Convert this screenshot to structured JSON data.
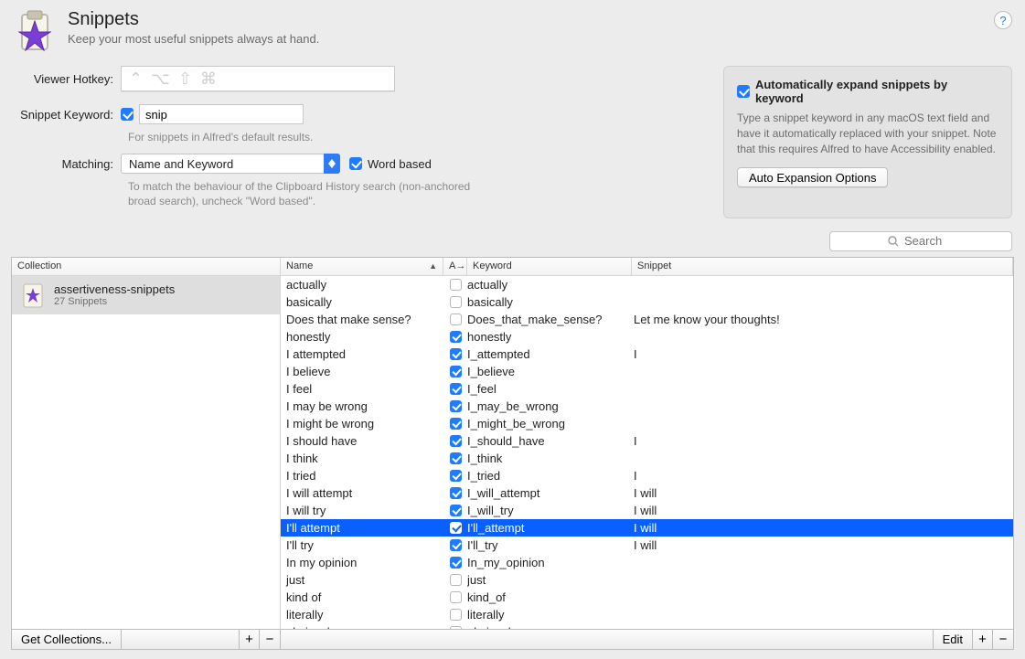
{
  "header": {
    "title": "Snippets",
    "subtitle": "Keep your most useful snippets always at hand."
  },
  "form": {
    "viewer_hotkey_label": "Viewer Hotkey:",
    "viewer_hotkey_glyphs": "⌃ ⌥ ⇧ ⌘",
    "snippet_keyword_label": "Snippet Keyword:",
    "snippet_keyword_value": "snip",
    "snippet_hint": "For snippets in Alfred's default results.",
    "matching_label": "Matching:",
    "matching_value": "Name and Keyword",
    "word_based_label": "Word based",
    "matching_hint": "To match the behaviour of the Clipboard History search (non-anchored broad search), uncheck \"Word based\"."
  },
  "panel": {
    "auto_label": "Automatically expand snippets by keyword",
    "desc": "Type a snippet keyword in any macOS text field and have it automatically replaced with your snippet. Note that this requires Alfred to have Accessibility enabled.",
    "button": "Auto Expansion Options"
  },
  "search": {
    "placeholder": "Search"
  },
  "left": {
    "header": "Collection",
    "collection_name": "assertiveness-snippets",
    "collection_count": "27 Snippets"
  },
  "right": {
    "cols": {
      "name": "Name",
      "a": "A→",
      "keyword": "Keyword",
      "snippet": "Snippet"
    }
  },
  "snippets": [
    {
      "name": "actually",
      "enabled": false,
      "keyword": "actually",
      "snippet": ""
    },
    {
      "name": "basically",
      "enabled": false,
      "keyword": "basically",
      "snippet": ""
    },
    {
      "name": "Does that make sense?",
      "enabled": false,
      "keyword": "Does_that_make_sense?",
      "snippet": "Let me know your thoughts!"
    },
    {
      "name": "honestly",
      "enabled": true,
      "keyword": "honestly",
      "snippet": ""
    },
    {
      "name": "I attempted",
      "enabled": true,
      "keyword": "I_attempted",
      "snippet": "I"
    },
    {
      "name": "I believe",
      "enabled": true,
      "keyword": "I_believe",
      "snippet": ""
    },
    {
      "name": "I feel",
      "enabled": true,
      "keyword": "I_feel",
      "snippet": ""
    },
    {
      "name": "I may be wrong",
      "enabled": true,
      "keyword": "I_may_be_wrong",
      "snippet": ""
    },
    {
      "name": "I might be wrong",
      "enabled": true,
      "keyword": "I_might_be_wrong",
      "snippet": ""
    },
    {
      "name": "I should have",
      "enabled": true,
      "keyword": "I_should_have",
      "snippet": "I"
    },
    {
      "name": "I think",
      "enabled": true,
      "keyword": "I_think",
      "snippet": ""
    },
    {
      "name": "I tried",
      "enabled": true,
      "keyword": "I_tried",
      "snippet": "I"
    },
    {
      "name": "I will attempt",
      "enabled": true,
      "keyword": "I_will_attempt",
      "snippet": "I will"
    },
    {
      "name": "I will try",
      "enabled": true,
      "keyword": "I_will_try",
      "snippet": "I will"
    },
    {
      "name": "I'll attempt",
      "enabled": true,
      "keyword": "I'll_attempt",
      "snippet": "I will",
      "selected": true
    },
    {
      "name": "I'll try",
      "enabled": true,
      "keyword": "I'll_try",
      "snippet": "I will"
    },
    {
      "name": "In my opinion",
      "enabled": true,
      "keyword": "In_my_opinion",
      "snippet": ""
    },
    {
      "name": "just",
      "enabled": false,
      "keyword": "just",
      "snippet": ""
    },
    {
      "name": "kind of",
      "enabled": false,
      "keyword": "kind_of",
      "snippet": ""
    },
    {
      "name": "literally",
      "enabled": false,
      "keyword": "literally",
      "snippet": ""
    },
    {
      "name": "obviously",
      "enabled": false,
      "keyword": "obviously",
      "snippet": ""
    }
  ],
  "bottom": {
    "get_collections": "Get Collections...",
    "edit": "Edit"
  }
}
